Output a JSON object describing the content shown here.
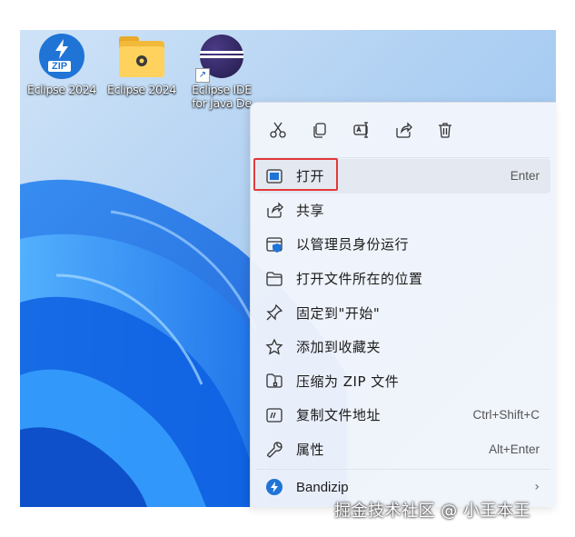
{
  "desktop": {
    "icons": [
      {
        "label": "Eclipse 2024",
        "icon": "bandizip-zip-icon"
      },
      {
        "label": "Eclipse 2024",
        "icon": "folder-icon"
      },
      {
        "label_line1": "Eclipse IDE",
        "label_line2": "for Java De",
        "icon": "eclipse-icon"
      }
    ]
  },
  "context_menu": {
    "toolbar": [
      "cut-icon",
      "copy-icon",
      "rename-icon",
      "share-icon",
      "delete-icon"
    ],
    "items": [
      {
        "label": "打开",
        "shortcut": "Enter",
        "icon": "open-icon"
      },
      {
        "label": "共享",
        "shortcut": "",
        "icon": "share-icon"
      },
      {
        "label": "以管理员身份运行",
        "shortcut": "",
        "icon": "shield-icon"
      },
      {
        "label": "打开文件所在的位置",
        "shortcut": "",
        "icon": "folder-icon"
      },
      {
        "label": "固定到\"开始\"",
        "shortcut": "",
        "icon": "pin-icon"
      },
      {
        "label": "添加到收藏夹",
        "shortcut": "",
        "icon": "star-icon"
      },
      {
        "label": "压缩为 ZIP 文件",
        "shortcut": "",
        "icon": "zip-icon"
      },
      {
        "label": "复制文件地址",
        "shortcut": "Ctrl+Shift+C",
        "icon": "copy-path-icon"
      },
      {
        "label": "属性",
        "shortcut": "Alt+Enter",
        "icon": "wrench-icon"
      }
    ],
    "bandizip": {
      "label": "Bandizip",
      "chevron": "›"
    }
  },
  "watermark": "掘金技术社区 @ 小王本王",
  "colors": {
    "highlight": "#e23a3a",
    "accent": "#1f74d6"
  }
}
